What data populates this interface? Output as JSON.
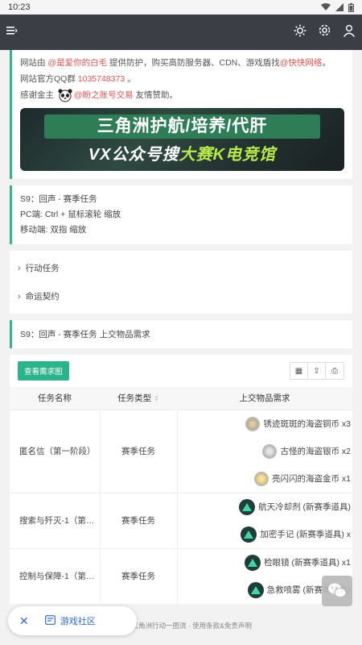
{
  "statusbar": {
    "time": "10:23"
  },
  "intro": {
    "line1_pre": "网站由 ",
    "line1_link1": "@是爱你的白毛",
    "line1_mid": " 提供防护，购买高防服务器、CDN、游戏盾找",
    "line1_link2": "@快快网络",
    "line1_end": "。",
    "line2_pre": "网站官方QQ群 ",
    "line2_qq": "1035748373",
    "line2_end": " 。",
    "line3_pre": "感谢金主 ",
    "line3_link": "@盼之账号交易",
    "line3_end": " 友情赞助。",
    "banner_top": "三角洲护航/培养/代肝",
    "banner_bottom_pre": "VX公众号搜 ",
    "banner_bottom_hl": "大赛K电竞馆"
  },
  "s9info": {
    "line1": "S9：回声 - 赛季任务",
    "line2": "PC端: Ctrl + 鼠标滚轮 缩放",
    "line3": "移动端: 双指 缩放"
  },
  "collapses": [
    "行动任务",
    "命运契约"
  ],
  "section_title": "S9：回声 - 赛季任务 上交物品需求",
  "table": {
    "button": "查看需求图",
    "headers": [
      "任务名称",
      "任务类型",
      "上交物品需求"
    ],
    "rows": [
      {
        "name": "匿名信（第一阶段）",
        "type": "赛季任务",
        "items": [
          {
            "icon": "copper-coin-icon",
            "text": "锈迹斑斑的海盗铜币 x3"
          },
          {
            "icon": "silver-coin-icon",
            "text": "古怪的海盗银币 x2"
          },
          {
            "icon": "gold-coin-icon",
            "text": "亮闪闪的海盗金币 x1"
          }
        ]
      },
      {
        "name": "搜索与歼灭-1（第…",
        "type": "赛季任务",
        "items": [
          {
            "icon": "season-item-icon",
            "text": "航天冷却剂 (新赛季道具)"
          },
          {
            "icon": "season-item-icon",
            "text": "加密手记 (新赛季道具) x"
          }
        ]
      },
      {
        "name": "控制与保障-1（第…",
        "type": "赛季任务",
        "items": [
          {
            "icon": "season-item-icon",
            "text": "检眼镜 (新赛季道具) x1"
          },
          {
            "icon": "season-item-icon",
            "text": "急救喷雾 (新赛季道具)"
          }
        ]
      }
    ]
  },
  "footer": "2026 · 三角洲行动一图流 · 使用条款&免责声明",
  "floatbar": {
    "label": "游戏社区"
  }
}
